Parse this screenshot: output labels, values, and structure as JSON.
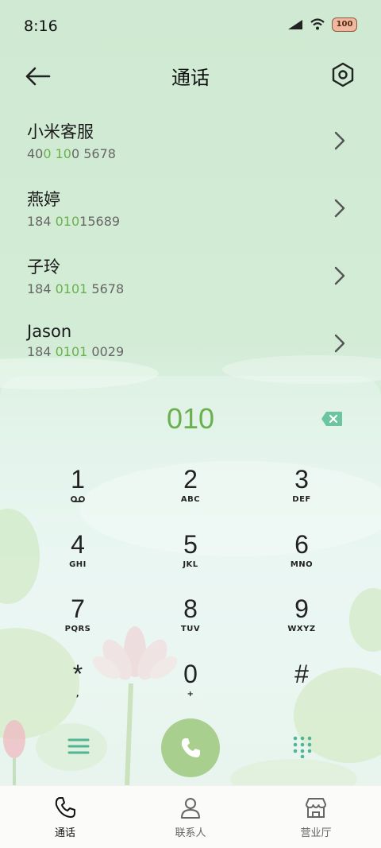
{
  "status_bar": {
    "time": "8:16",
    "battery": "100"
  },
  "header": {
    "title": "通话"
  },
  "contacts": [
    {
      "name": "小米客服",
      "number_parts": [
        "40",
        "0 10",
        "0 5678"
      ]
    },
    {
      "name": "燕婷",
      "number_parts": [
        "184 ",
        "010",
        "15689"
      ]
    },
    {
      "name": "子玲",
      "number_parts": [
        "184 ",
        "0101",
        " 5678"
      ]
    },
    {
      "name": "Jason",
      "number_parts": [
        "184 ",
        "0101",
        " 0029"
      ]
    }
  ],
  "dialpad": {
    "input": "010",
    "keys": [
      {
        "digit": "1",
        "letters": ""
      },
      {
        "digit": "2",
        "letters": "ABC"
      },
      {
        "digit": "3",
        "letters": "DEF"
      },
      {
        "digit": "4",
        "letters": "GHI"
      },
      {
        "digit": "5",
        "letters": "JKL"
      },
      {
        "digit": "6",
        "letters": "MNO"
      },
      {
        "digit": "7",
        "letters": "PQRS"
      },
      {
        "digit": "8",
        "letters": "TUV"
      },
      {
        "digit": "9",
        "letters": "WXYZ"
      },
      {
        "digit": "*",
        "letters": ","
      },
      {
        "digit": "0",
        "letters": "+"
      },
      {
        "digit": "#",
        "letters": ""
      }
    ]
  },
  "tabs": [
    {
      "label": "通话",
      "icon": "phone-icon",
      "active": true
    },
    {
      "label": "联系人",
      "icon": "person-icon",
      "active": false
    },
    {
      "label": "营业厅",
      "icon": "store-icon",
      "active": false
    }
  ],
  "colors": {
    "accent": "#6ab04c",
    "call_button": "#a9cf8f",
    "teal_icon": "#4fb596"
  }
}
